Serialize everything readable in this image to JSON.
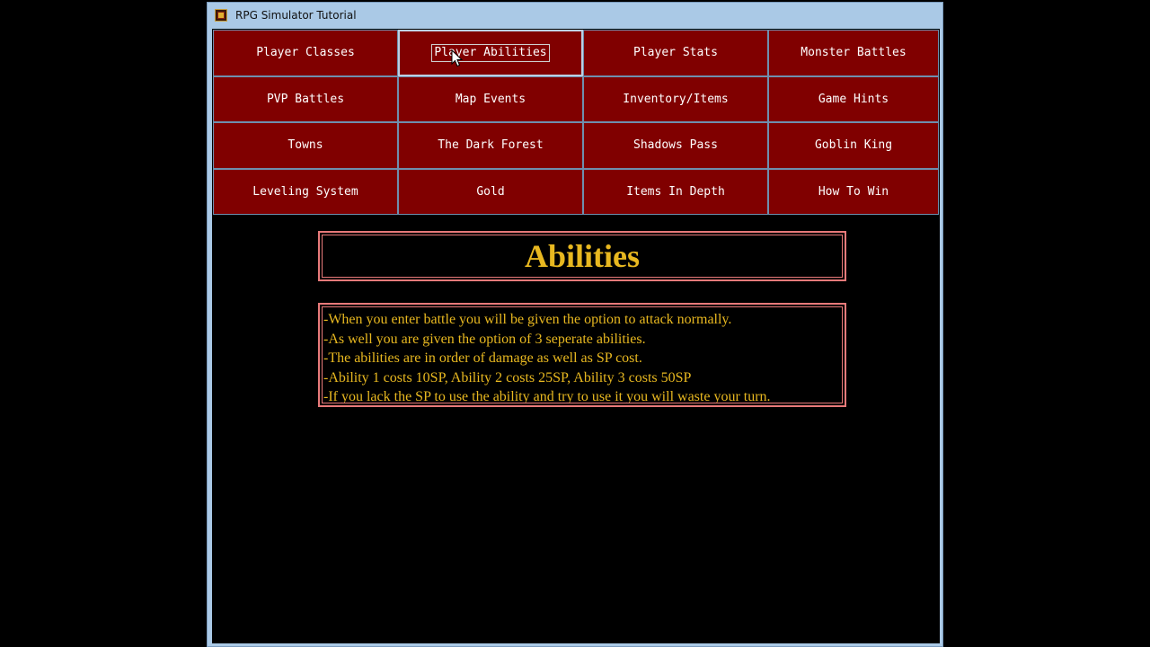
{
  "window": {
    "title": "RPG Simulator Tutorial"
  },
  "nav": {
    "rows": [
      [
        "Player Classes",
        "Player Abilities",
        "Player Stats",
        "Monster Battles"
      ],
      [
        "PVP Battles",
        "Map Events",
        "Inventory/Items",
        "Game Hints"
      ],
      [
        "Towns",
        "The Dark Forest",
        "Shadows Pass",
        "Goblin King"
      ],
      [
        "Leveling System",
        "Gold",
        "Items In Depth",
        "How To Win"
      ]
    ],
    "active": "Player Abilities"
  },
  "content": {
    "heading": "Abilities",
    "lines": [
      "-When you enter battle you will be given the option to attack normally.",
      "-As well you are given the option of 3 seperate abilities.",
      "-The abilities are in order of damage as well as SP cost.",
      "-Ability 1 costs 10SP, Ability 2 costs 25SP, Ability 3 costs 50SP",
      "-If you lack the SP to use the ability and try to use it you will waste your turn."
    ]
  },
  "colors": {
    "button_bg": "#800000",
    "heading_text": "#e8b820",
    "box_border": "#e87a7a",
    "window_frame": "#aac9e6"
  },
  "icons": {
    "app": "rpg-app-icon",
    "cursor": "mouse-pointer-icon"
  }
}
